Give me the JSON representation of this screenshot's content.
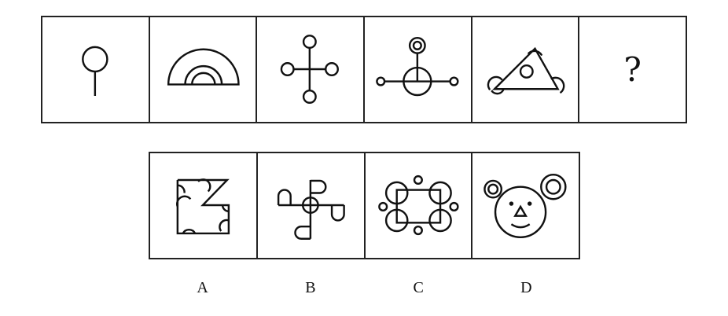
{
  "puzzle": {
    "question_sequence": [
      {
        "id": "q1",
        "figure": "circle-on-stick"
      },
      {
        "id": "q2",
        "figure": "nested-semicircles"
      },
      {
        "id": "q3",
        "figure": "cross-with-four-circles"
      },
      {
        "id": "q4",
        "figure": "circle-with-branches"
      },
      {
        "id": "q5",
        "figure": "triangle-with-circles"
      },
      {
        "id": "q6",
        "figure": "question-mark",
        "text": "?"
      }
    ],
    "options": [
      {
        "label": "A",
        "figure": "notched-square-with-half-circles"
      },
      {
        "label": "B",
        "figure": "pinwheel-with-loops"
      },
      {
        "label": "C",
        "figure": "rectangle-with-circles"
      },
      {
        "label": "D",
        "figure": "bear-face"
      }
    ]
  }
}
